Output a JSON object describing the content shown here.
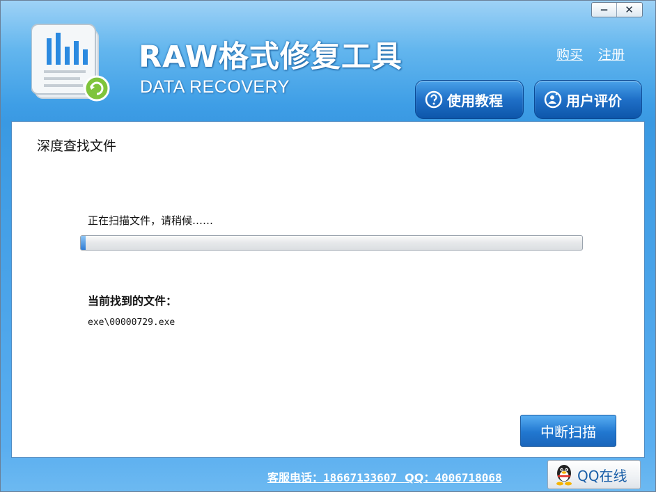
{
  "window": {
    "controls": {
      "minimize": "−",
      "close": "✕"
    }
  },
  "header": {
    "title": "RAW格式修复工具",
    "subtitle": "DATA RECOVERY",
    "links": {
      "buy": "购买",
      "register": "注册"
    },
    "buttons": {
      "tutorial": "使用教程",
      "reviews": "用户评价"
    }
  },
  "panel": {
    "title": "深度查找文件",
    "scan_status": "正在扫描文件，请稍候……",
    "progress": 0.01,
    "found_label": "当前找到的文件：",
    "found_file": "exe\\00000729.exe",
    "stop_button": "中断扫描"
  },
  "footer": {
    "service_label": "客服电话：",
    "phone": "18667133607",
    "qq_label": "QQ：",
    "qq_number": "4006718068",
    "qq_button": "QQ在线"
  },
  "icons": {
    "logo": "document-chart-refresh-icon",
    "tutorial": "question-circle-icon",
    "reviews": "user-review-icon",
    "qq": "qq-penguin-icon"
  },
  "colors": {
    "header_blue": "#3e9ee6",
    "button_blue": "#1f6fc7",
    "progress_fill": "#2f7cd4"
  }
}
